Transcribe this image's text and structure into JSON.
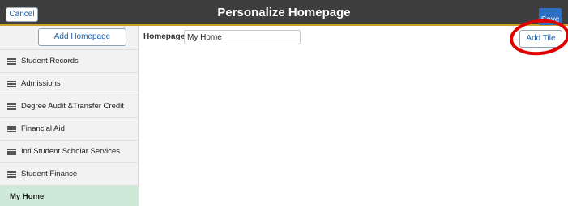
{
  "header": {
    "cancel_label": "Cancel",
    "title": "Personalize Homepage",
    "save_label": "Save"
  },
  "sidebar": {
    "add_homepage_label": "Add Homepage",
    "items": [
      {
        "label": "Student Records",
        "icon": "hamburger-menu-icon"
      },
      {
        "label": "Admissions",
        "icon": "hamburger-menu-icon"
      },
      {
        "label": "Degree Audit &Transfer Credit",
        "icon": "hamburger-menu-icon"
      },
      {
        "label": "Financial Aid",
        "icon": "hamburger-menu-icon"
      },
      {
        "label": "Intl Student Scholar Services",
        "icon": "hamburger-menu-icon"
      },
      {
        "label": "Student Finance",
        "icon": "hamburger-menu-icon"
      },
      {
        "label": "My Home",
        "selected": true
      }
    ]
  },
  "main": {
    "homepage_label": "Homepage",
    "homepage_value": "My Home",
    "add_tile_label": "Add Tile"
  },
  "colors": {
    "header_bg": "#3e3e3e",
    "accent_blue": "#2d6fc5",
    "selected_item_bg": "#cfe9d9",
    "annotation_red": "#e00000"
  }
}
